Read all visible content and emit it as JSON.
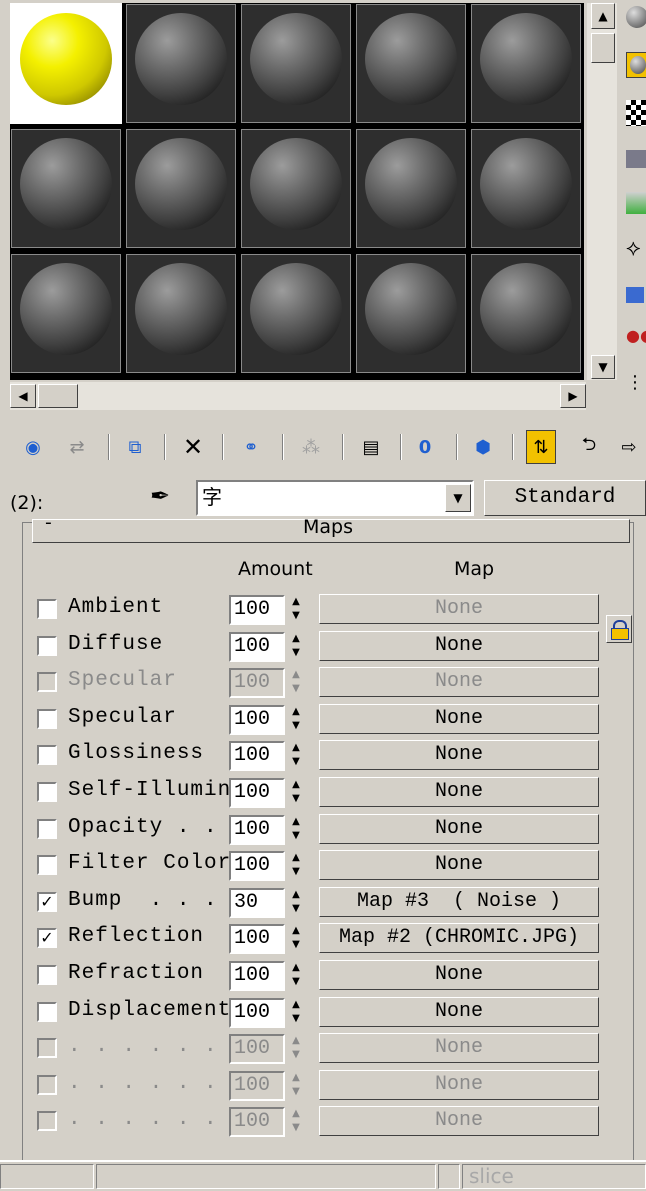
{
  "slots": [
    {
      "active": true
    },
    {},
    {},
    {},
    {},
    {},
    {},
    {},
    {},
    {},
    {},
    {},
    {},
    {},
    {}
  ],
  "material": {
    "level": "(2):",
    "name": "字",
    "type": "Standard"
  },
  "maps": {
    "rollout_title": "Maps",
    "amount_header": "Amount",
    "map_header": "Map",
    "rows": [
      {
        "label": "Ambient",
        "checked": false,
        "enabled": true,
        "amount": "100",
        "map": "None",
        "map_disabled": true
      },
      {
        "label": "Diffuse",
        "checked": false,
        "enabled": true,
        "amount": "100",
        "map": "None"
      },
      {
        "label": "Specular",
        "checked": false,
        "enabled": false,
        "amount": "100",
        "map": "None"
      },
      {
        "label": "Specular",
        "checked": false,
        "enabled": true,
        "amount": "100",
        "map": "None"
      },
      {
        "label": "Glossiness",
        "checked": false,
        "enabled": true,
        "amount": "100",
        "map": "None"
      },
      {
        "label": "Self-Illumin",
        "checked": false,
        "enabled": true,
        "amount": "100",
        "map": "None"
      },
      {
        "label": "Opacity . .",
        "checked": false,
        "enabled": true,
        "amount": "100",
        "map": "None"
      },
      {
        "label": "Filter Color",
        "checked": false,
        "enabled": true,
        "amount": "100",
        "map": "None"
      },
      {
        "label": "Bump  . . .",
        "checked": true,
        "enabled": true,
        "amount": "30",
        "map": "Map #3  ( Noise )"
      },
      {
        "label": "Reflection",
        "checked": true,
        "enabled": true,
        "amount": "100",
        "map": "Map #2 (CHROMIC.JPG)"
      },
      {
        "label": "Refraction",
        "checked": false,
        "enabled": true,
        "amount": "100",
        "map": "None"
      },
      {
        "label": "Displacement",
        "checked": false,
        "enabled": true,
        "amount": "100",
        "map": "None"
      },
      {
        "label": ". . . . . . .",
        "checked": false,
        "enabled": false,
        "amount": "100",
        "map": "None"
      },
      {
        "label": ". . . . . . .",
        "checked": false,
        "enabled": false,
        "amount": "100",
        "map": "None"
      },
      {
        "label": ". . . . . . .",
        "checked": false,
        "enabled": false,
        "amount": "100",
        "map": "None"
      }
    ]
  },
  "status_bar": {
    "cell_right": "slice"
  },
  "colors": {
    "slot_bg": "#2e2e2e",
    "active_sphere": "#f4f000",
    "panel_bg": "#d4d0c8"
  }
}
